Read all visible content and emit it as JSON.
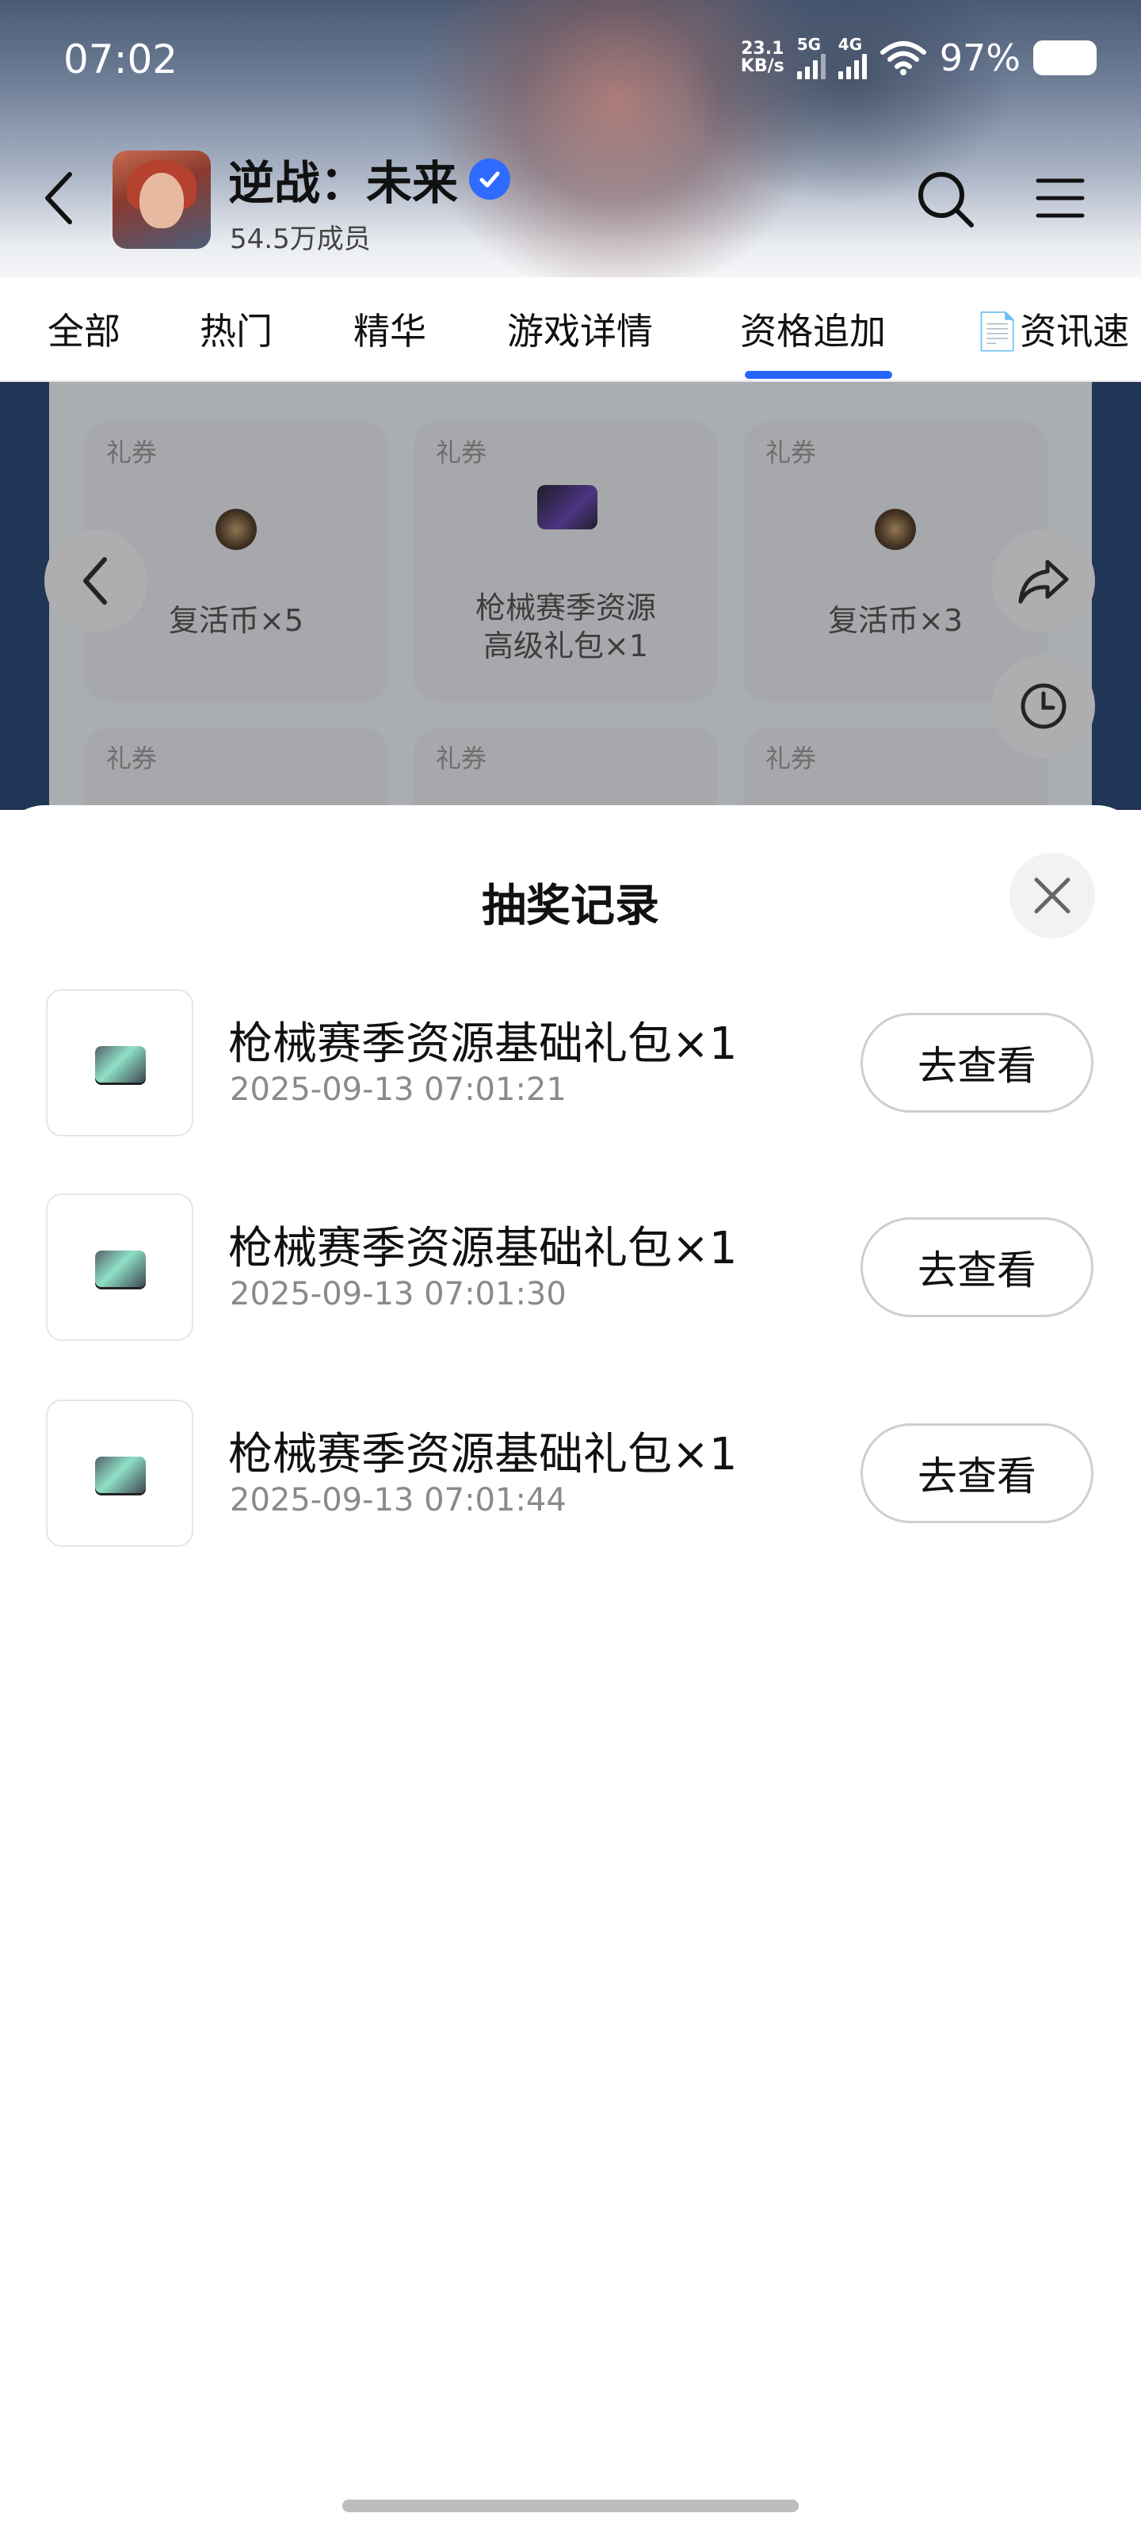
{
  "status_bar": {
    "time": "07:02",
    "net_speed_value": "23.1",
    "net_speed_unit": "KB/s",
    "sim1": "5G",
    "sim2": "4G",
    "battery": "97%"
  },
  "header": {
    "title": "逆战：未来",
    "members": "54.5万成员"
  },
  "tabs": [
    {
      "label": "全部"
    },
    {
      "label": "热门"
    },
    {
      "label": "精华"
    },
    {
      "label": "游戏详情"
    },
    {
      "label": "资格追加",
      "active": true
    },
    {
      "label": "📄资讯速"
    }
  ],
  "background": {
    "cards": [
      {
        "tag": "礼券",
        "name": "复活币×5"
      },
      {
        "tag": "礼券",
        "name_line1": "枪械赛季资源",
        "name_line2": "高级礼包×1"
      },
      {
        "tag": "礼券",
        "name": "复活币×3"
      },
      {
        "tag": "礼券"
      },
      {
        "tag": "礼券"
      },
      {
        "tag": "礼券"
      }
    ]
  },
  "sheet": {
    "title": "抽奖记录",
    "records": [
      {
        "name": "枪械赛季资源基础礼包×1",
        "time": "2025-09-13 07:01:21",
        "action": "去查看"
      },
      {
        "name": "枪械赛季资源基础礼包×1",
        "time": "2025-09-13 07:01:30",
        "action": "去查看"
      },
      {
        "name": "枪械赛季资源基础礼包×1",
        "time": "2025-09-13 07:01:44",
        "action": "去查看"
      }
    ]
  },
  "colors": {
    "accent": "#2566ff",
    "verified": "#2f6bff"
  }
}
